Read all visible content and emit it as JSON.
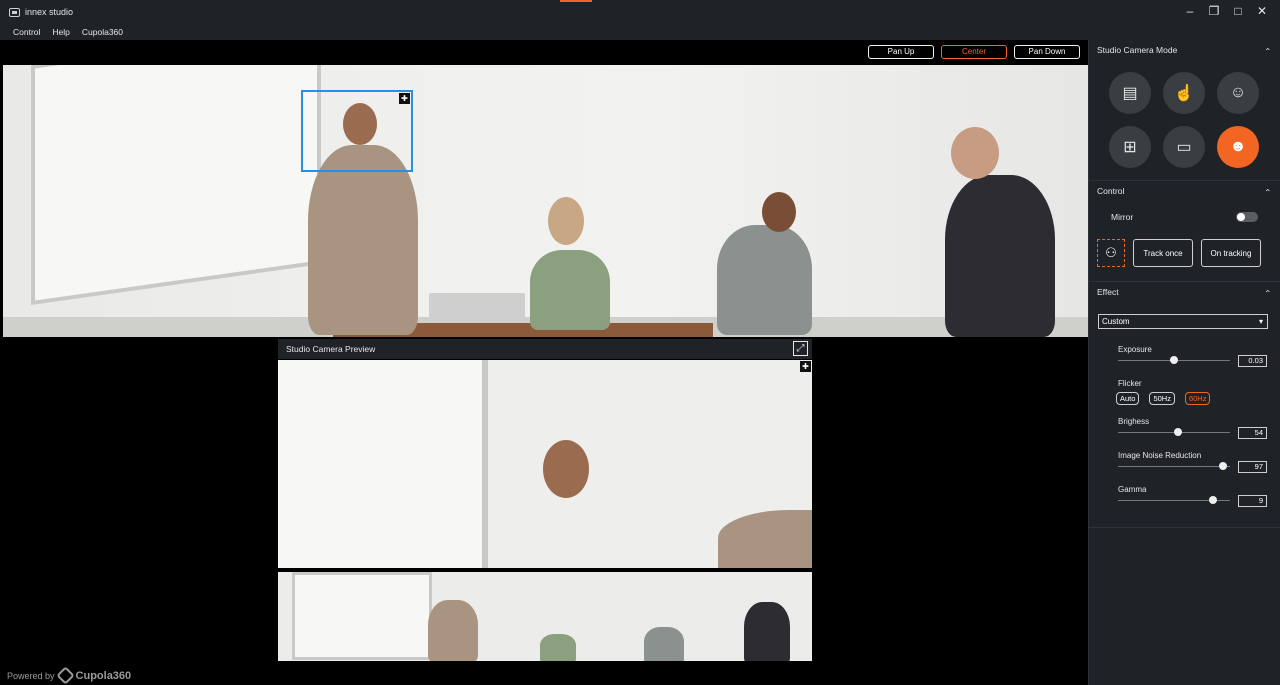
{
  "app": {
    "title": "innex studio"
  },
  "menu": [
    "Control",
    "Help",
    "Cupola360"
  ],
  "pan": {
    "up": "Pan Up",
    "center": "Center",
    "down": "Pan Down"
  },
  "preview": {
    "title": "Studio Camera Preview"
  },
  "footer": {
    "powered_by": "Powered by",
    "brand": "Cupola360"
  },
  "panel": {
    "mode_section": "Studio Camera Mode",
    "control_section": "Control",
    "mirror_label": "Mirror",
    "track_once": "Track once",
    "on_tracking": "On tracking",
    "effect_section": "Effect",
    "preset": "Custom",
    "exposure": {
      "label": "Exposure",
      "value": "0.03",
      "level": 0.5
    },
    "flicker": {
      "label": "Flicker",
      "options": [
        "Auto",
        "50Hz",
        "60Hz"
      ],
      "selected": "60Hz"
    },
    "brightness": {
      "label": "Brighess",
      "value": "54",
      "level": 0.54
    },
    "noise": {
      "label": "Image Noise Reduction",
      "value": "97",
      "level": 0.94
    },
    "gamma": {
      "label": "Gamma",
      "value": "9",
      "level": 0.85
    }
  },
  "colors": {
    "accent": "#f26522",
    "tracking_box": "#2a8fe0",
    "panel_bg": "#1f2227"
  }
}
